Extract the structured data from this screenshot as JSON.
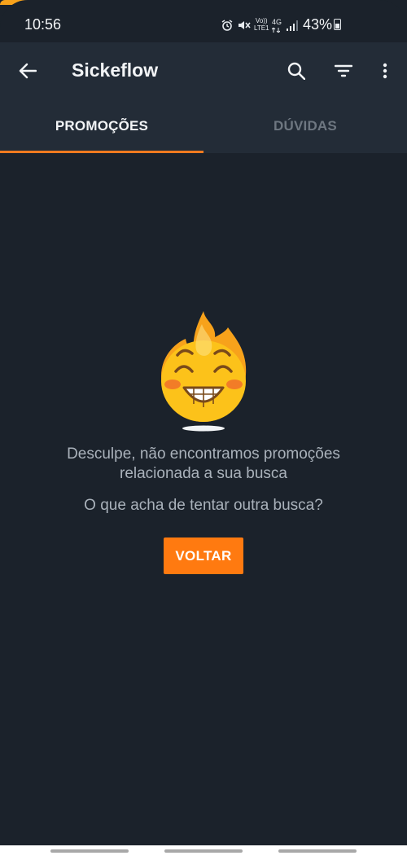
{
  "status_bar": {
    "time": "10:56",
    "battery": "43%",
    "icons": [
      "alarm-icon",
      "mute-icon",
      "volte-icon",
      "4g-icon",
      "signal-icon",
      "battery-icon"
    ],
    "volte_label": "Vo))\nLTE1",
    "net_label": "4G"
  },
  "app_bar": {
    "title": "Sickeflow",
    "icons": [
      "arrow-left-icon",
      "search-icon",
      "filter-icon",
      "more-vert-icon"
    ]
  },
  "tabs": [
    {
      "label": "PROMOÇÕES",
      "active": true
    },
    {
      "label": "DÚVIDAS",
      "active": false
    }
  ],
  "empty_state": {
    "title_line1": "Desculpe, não encontramos promoções",
    "title_line2": "relacionada a sua busca",
    "subtitle": "O que acha de tentar outra busca?",
    "button_label": "VOLTAR"
  },
  "colors": {
    "background": "#1b222b",
    "app_bar": "#232c37",
    "accent": "#ff7a10",
    "muted_text": "#aab2bb"
  }
}
